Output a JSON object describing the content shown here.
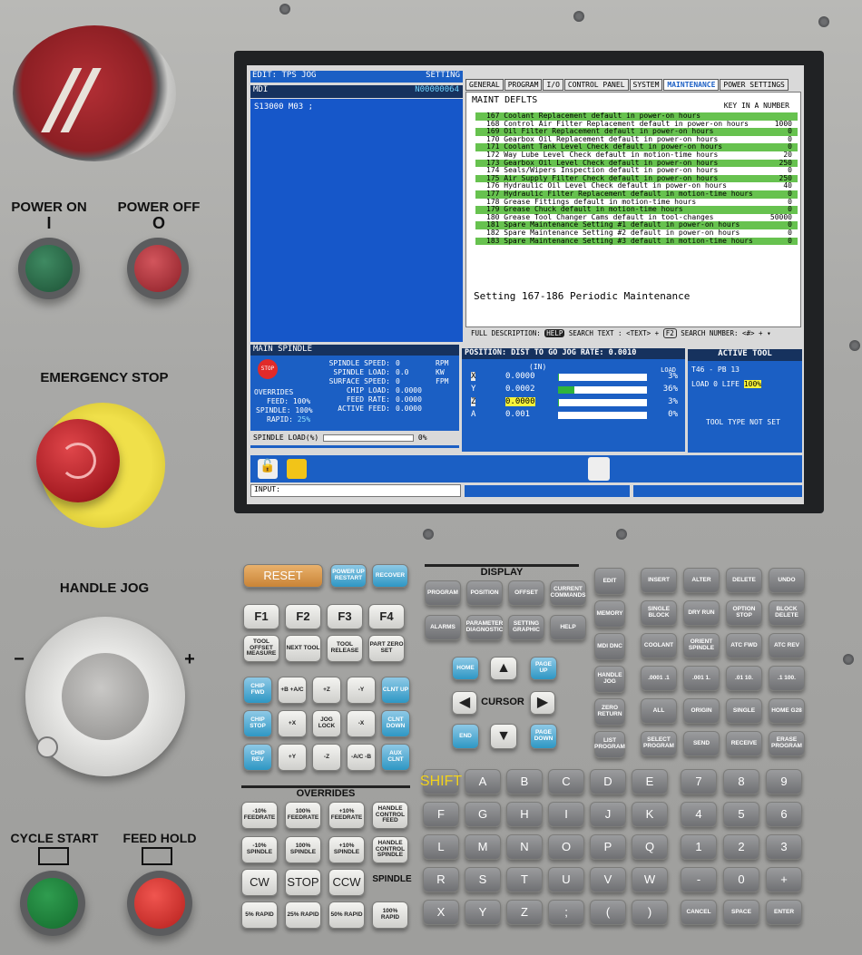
{
  "controls": {
    "power_on": "POWER ON",
    "power_on_symbol": "I",
    "power_off": "POWER OFF",
    "power_off_symbol": "O",
    "emergency_stop": "EMERGENCY STOP",
    "handle_jog": "HANDLE JOG",
    "cycle_start": "CYCLE START",
    "feed_hold": "FEED HOLD",
    "dial_minus": "−",
    "dial_plus": "+"
  },
  "screen": {
    "edit_header": "EDIT: TPS JOG",
    "setting_header": "SETTING",
    "mdi_title": "MDI",
    "mdi_program": "N00000064",
    "mdi_code": "S13000 M03 ;",
    "tabs": [
      "GENERAL",
      "PROGRAM",
      "I/O",
      "CONTROL PANEL",
      "SYSTEM",
      "MAINTENANCE",
      "POWER SETTINGS"
    ],
    "active_tab": "MAINTENANCE",
    "maint_title": "MAINT DEFLTS",
    "maint_hint": "KEY IN A NUMBER",
    "maint_rows": [
      {
        "text": "167 Coolant Replacement default in power-on hours",
        "value": "",
        "highlight": true
      },
      {
        "text": "168 Control Air Filter Replacement default in power-on hours",
        "value": "1000",
        "highlight": false
      },
      {
        "text": "169 Oil Filter Replacement default in power-on hours",
        "value": "0",
        "highlight": true
      },
      {
        "text": "170 Gearbox Oil Replacement default in power-on hours",
        "value": "0",
        "highlight": false
      },
      {
        "text": "171 Coolant Tank Level Check default in power-on hours",
        "value": "0",
        "highlight": true
      },
      {
        "text": "172 Way Lube Level Check default in motion-time hours",
        "value": "20",
        "highlight": false
      },
      {
        "text": "173 Gearbox Oil Level Check default in power-on hours",
        "value": "250",
        "highlight": true
      },
      {
        "text": "174 Seals/Wipers Inspection default in power-on hours",
        "value": "0",
        "highlight": false
      },
      {
        "text": "175 Air Supply Filter Check default in power-on hours",
        "value": "250",
        "highlight": true
      },
      {
        "text": "176 Hydraulic Oil Level Check default in power-on hours",
        "value": "40",
        "highlight": false
      },
      {
        "text": "177 Hydraulic Filter Replacement default in motion-time hours",
        "value": "0",
        "highlight": true
      },
      {
        "text": "178 Grease Fittings default in motion-time hours",
        "value": "0",
        "highlight": false
      },
      {
        "text": "179 Grease Chuck default in motion-time hours",
        "value": "0",
        "highlight": true
      },
      {
        "text": "180 Grease Tool Changer Cams default in tool-changes",
        "value": "50000",
        "highlight": false
      },
      {
        "text": "181 Spare Maintenance Setting #1 default in power-on hours",
        "value": "0",
        "highlight": true
      },
      {
        "text": "182 Spare Maintenance Setting #2 default in power-on hours",
        "value": "0",
        "highlight": false
      },
      {
        "text": "183 Spare Maintenance Setting #3 default in motion-time hours",
        "value": "0",
        "highlight": true
      }
    ],
    "setting_desc": "Setting 167-186 Periodic Maintenance",
    "footer_full_desc": "FULL DESCRIPTION:",
    "footer_help_key": "HELP",
    "footer_search_text": "SEARCH TEXT : <TEXT> +",
    "footer_f2": "F2",
    "footer_search_number": "SEARCH NUMBER: <#> +",
    "spindle": {
      "title": "MAIN SPINDLE",
      "stop": "STOP",
      "overrides": "OVERRIDES",
      "feed": "FEED: 100%",
      "spindle": "SPINDLE: 100%",
      "rapid_label": "RAPID:",
      "rapid_value": "25%",
      "rows": [
        {
          "label": "SPINDLE SPEED:",
          "value": "0",
          "unit": "RPM"
        },
        {
          "label": "SPINDLE LOAD:",
          "value": "0.0",
          "unit": "KW"
        },
        {
          "label": "SURFACE SPEED:",
          "value": "0",
          "unit": "FPM"
        },
        {
          "label": "CHIP LOAD:",
          "value": "0.0000",
          "unit": ""
        },
        {
          "label": "FEED RATE:",
          "value": "0.0000",
          "unit": ""
        },
        {
          "label": "ACTIVE FEED:",
          "value": "0.0000",
          "unit": ""
        }
      ],
      "load_label": "SPINDLE LOAD(%)",
      "load_value": "0%"
    },
    "position": {
      "title": "POSITION: DIST TO GO  JOG RATE: 0.0010",
      "unit": "(IN)",
      "load_header": "LOAD",
      "axes": [
        {
          "axis": "X",
          "value": "0.0000",
          "load": "3%"
        },
        {
          "axis": "Y",
          "value": "0.0002",
          "load": "36%"
        },
        {
          "axis": "Z",
          "value": "0.0000",
          "load": "3%"
        },
        {
          "axis": "A",
          "value": "0.001",
          "load": "0%"
        }
      ]
    },
    "tool": {
      "title": "ACTIVE TOOL",
      "line1": "T46  - PB  13",
      "load": "LOAD 0",
      "life_label": "LIFE",
      "life_value": "100%",
      "type": "TOOL TYPE NOT SET"
    },
    "input_label": "INPUT:"
  },
  "keypad": {
    "display_title": "DISPLAY",
    "cursor_title": "CURSOR",
    "overrides_title": "OVERRIDES",
    "spindle_label": "SPINDLE",
    "reset": "RESET",
    "powerup": "POWER UP RESTART",
    "recover": "RECOVER",
    "f_keys": [
      "F1",
      "F2",
      "F3",
      "F4"
    ],
    "tool_keys": [
      "TOOL OFFSET MEASURE",
      "NEXT TOOL",
      "TOOL RELEASE",
      "PART ZERO SET"
    ],
    "display_keys": [
      "PROGRAM",
      "POSITION",
      "OFFSET",
      "CURRENT COMMANDS",
      "ALARMS",
      "PARAMETER DIAGNOSTIC",
      "SETTING GRAPHIC",
      "HELP"
    ],
    "jog_keys": [
      "CHIP FWD",
      "+B +A/C",
      "+Z",
      "-Y",
      "CLNT UP",
      "CHIP STOP",
      "+X",
      "JOG LOCK",
      "-X",
      "CLNT DOWN",
      "CHIP REV",
      "+Y",
      "-Z",
      "-A/C -B",
      "AUX CLNT"
    ],
    "cursor_keys": [
      "HOME",
      "PAGE UP",
      "END",
      "PAGE DOWN"
    ],
    "override_keys": [
      "-10% FEEDRATE",
      "100% FEEDRATE",
      "+10% FEEDRATE",
      "HANDLE CONTROL FEED",
      "-10% SPINDLE",
      "100% SPINDLE",
      "+10% SPINDLE",
      "HANDLE CONTROL SPINDLE",
      "CW",
      "STOP",
      "CCW",
      "5% RAPID",
      "25% RAPID",
      "50% RAPID",
      "100% RAPID"
    ],
    "edit_keys": [
      "EDIT",
      "MEMORY",
      "MDI DNC",
      "HANDLE JOG",
      "ZERO RETURN",
      "LIST PROGRAM"
    ],
    "right_keys": [
      "INSERT",
      "ALTER",
      "DELETE",
      "UNDO",
      "SINGLE BLOCK",
      "DRY RUN",
      "OPTION STOP",
      "BLOCK DELETE",
      "COOLANT",
      "ORIENT SPINDLE",
      "ATC FWD",
      "ATC REV",
      ".0001 .1",
      ".001 1.",
      ".01 10.",
      ".1 100.",
      "ALL",
      "ORIGIN",
      "SINGLE",
      "HOME G28",
      "SELECT PROGRAM",
      "SEND",
      "RECEIVE",
      "ERASE PROGRAM"
    ],
    "alpha_keys": [
      "SHIFT",
      "A",
      "B",
      "C",
      "D",
      "E",
      "F",
      "G",
      "H",
      "I",
      "J",
      "K",
      "L",
      "M",
      "N",
      "O",
      "P",
      "Q",
      "R",
      "S",
      "T",
      "U",
      "V",
      "W",
      "X",
      "Y",
      "Z",
      ";",
      "(",
      ")"
    ],
    "num_keys": [
      "7",
      "8",
      "9",
      "4",
      "5",
      "6",
      "1",
      "2",
      "3",
      "-",
      "0",
      "+",
      "CANCEL",
      "SPACE",
      "ENTER"
    ]
  }
}
